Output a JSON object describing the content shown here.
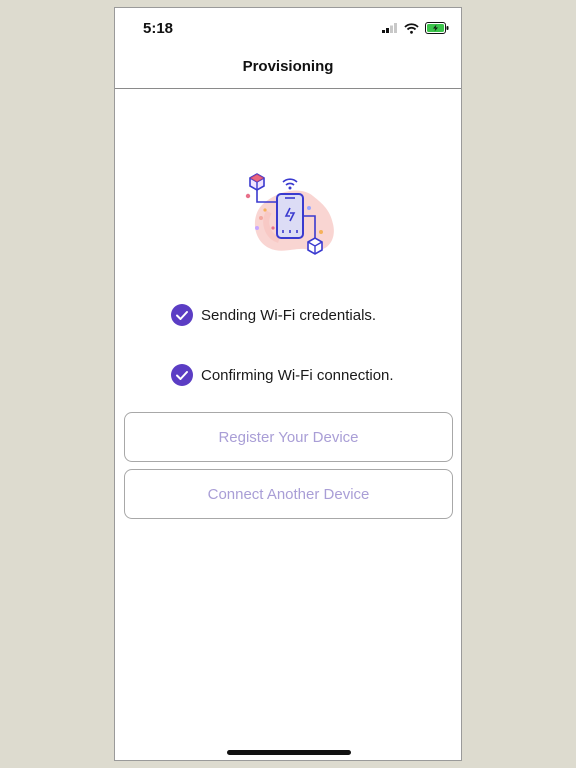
{
  "status_bar": {
    "time": "5:18"
  },
  "nav": {
    "title": "Provisioning"
  },
  "steps": [
    {
      "label": "Sending Wi-Fi credentials.",
      "done": true
    },
    {
      "label": "Confirming Wi-Fi connection.",
      "done": true
    }
  ],
  "buttons": {
    "register": "Register Your Device",
    "connect_another": "Connect Another Device"
  },
  "colors": {
    "accent": "#5b3dc4",
    "button_text": "#a99ed6",
    "background": "#dddbcf"
  }
}
